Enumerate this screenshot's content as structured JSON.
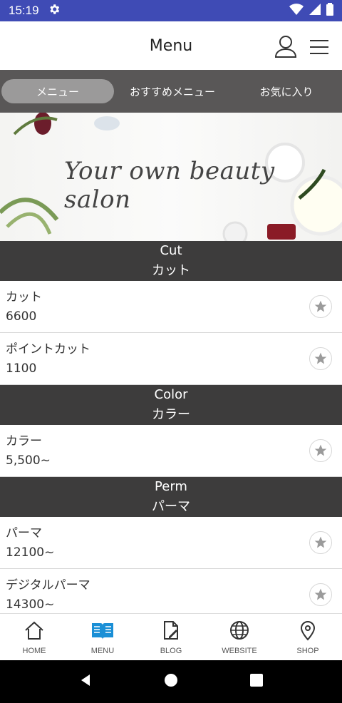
{
  "status_bar": {
    "time": "15:19",
    "settings_icon": "gear-icon",
    "wifi_icon": "wifi-icon",
    "signal_icon": "signal-icon",
    "battery_icon": "battery-icon"
  },
  "header": {
    "title": "Menu",
    "user_icon": "user-icon",
    "menu_icon": "hamburger-icon"
  },
  "tabs": [
    {
      "label": "メニュー",
      "active": true
    },
    {
      "label": "おすすめメニュー",
      "active": false
    },
    {
      "label": "お気に入り",
      "active": false
    }
  ],
  "banner": {
    "text": "Your own beauty salon"
  },
  "sections": [
    {
      "title_en": "Cut",
      "title_jp": "カット",
      "items": [
        {
          "name": "カット",
          "price": "6600"
        },
        {
          "name": "ポイントカット",
          "price": "1100"
        }
      ]
    },
    {
      "title_en": "Color",
      "title_jp": "カラー",
      "items": [
        {
          "name": "カラー",
          "price": "5,500~"
        }
      ]
    },
    {
      "title_en": "Perm",
      "title_jp": "パーマ",
      "items": [
        {
          "name": "パーマ",
          "price": "12100~"
        },
        {
          "name": "デジタルパーマ",
          "price": "14300~"
        }
      ]
    }
  ],
  "bottom_nav": [
    {
      "label": "HOME",
      "icon": "home-icon",
      "active": false
    },
    {
      "label": "MENU",
      "icon": "book-icon",
      "active": true
    },
    {
      "label": "BLOG",
      "icon": "blog-icon",
      "active": false
    },
    {
      "label": "WEBSITE",
      "icon": "globe-icon",
      "active": false
    },
    {
      "label": "SHOP",
      "icon": "location-pin-icon",
      "active": false
    }
  ],
  "colors": {
    "status_bar": "#3f4bb5",
    "tab_bar": "#595757",
    "section_header": "#3d3c3c",
    "nav_active": "#1a8fd6"
  }
}
